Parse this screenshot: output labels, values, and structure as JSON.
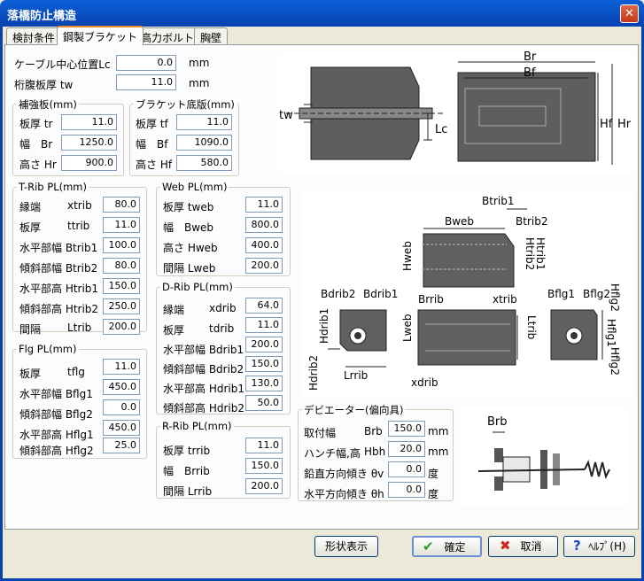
{
  "window": {
    "title": "落橋防止構造",
    "close": "✕"
  },
  "tabs": [
    "検討条件",
    "鋼製ブラケット",
    "高力ボルト",
    "胸壁"
  ],
  "top": {
    "lc_label": "ケーブル中心位置Lc",
    "lc_value": "0.0",
    "lc_unit": "mm",
    "tw_label": "桁腹板厚 tw",
    "tw_value": "11.0",
    "tw_unit": "mm"
  },
  "hokyo": {
    "title": "補強板(mm)",
    "rows": [
      {
        "label": "板厚 tr",
        "value": "11.0"
      },
      {
        "label": "幅　Br",
        "value": "1250.0"
      },
      {
        "label": "高さ Hr",
        "value": "900.0"
      }
    ]
  },
  "bracket_base": {
    "title": "ブラケット底版(mm)",
    "rows": [
      {
        "label": "板厚 tf",
        "value": "11.0"
      },
      {
        "label": "幅　Bf",
        "value": "1090.0"
      },
      {
        "label": "高さ Hf",
        "value": "580.0"
      }
    ]
  },
  "trib": {
    "title": "T-Rib PL(mm)",
    "rows": [
      {
        "label": "縁端",
        "sym": "xtrib",
        "value": "80.0"
      },
      {
        "label": "板厚",
        "sym": "ttrib",
        "value": "11.0"
      },
      {
        "label": "水平部幅 Btrib1",
        "sym": "",
        "value": "100.0"
      },
      {
        "label": "傾斜部幅 Btrib2",
        "sym": "",
        "value": "80.0"
      },
      {
        "label": "水平部高 Htrib1",
        "sym": "",
        "value": "150.0"
      },
      {
        "label": "傾斜部高 Htrib2",
        "sym": "",
        "value": "250.0"
      },
      {
        "label": "間隔",
        "sym": "Ltrib",
        "value": "200.0"
      }
    ]
  },
  "flg": {
    "title": "Flg PL(mm)",
    "rows": [
      {
        "label": "板厚",
        "sym": "tflg",
        "value": "11.0"
      },
      {
        "label": "水平部幅 Bflg1",
        "sym": "",
        "value": "450.0"
      },
      {
        "label": "傾斜部幅 Bflg2",
        "sym": "",
        "value": "0.0"
      },
      {
        "label": "水平部高 Hflg1",
        "sym": "",
        "value": "450.0"
      },
      {
        "label": "傾斜部高 Hflg2",
        "sym": "",
        "value": "25.0"
      }
    ]
  },
  "web": {
    "title": "Web PL(mm)",
    "rows": [
      {
        "label": "板厚 tweb",
        "value": "11.0"
      },
      {
        "label": "幅　Bweb",
        "value": "800.0"
      },
      {
        "label": "高さ Hweb",
        "value": "400.0"
      },
      {
        "label": "間隔 Lweb",
        "value": "200.0"
      }
    ]
  },
  "drib": {
    "title": "D-Rib PL(mm)",
    "rows": [
      {
        "label": "縁端",
        "sym": "xdrib",
        "value": "64.0"
      },
      {
        "label": "板厚",
        "sym": "tdrib",
        "value": "11.0"
      },
      {
        "label": "水平部幅 Bdrib1",
        "sym": "",
        "value": "200.0"
      },
      {
        "label": "傾斜部幅 Bdrib2",
        "sym": "",
        "value": "150.0"
      },
      {
        "label": "水平部高 Hdrib1",
        "sym": "",
        "value": "130.0"
      },
      {
        "label": "傾斜部高 Hdrib2",
        "sym": "",
        "value": "50.0"
      }
    ]
  },
  "rrib": {
    "title": "R-Rib PL(mm)",
    "rows": [
      {
        "label": "板厚 trrib",
        "value": "11.0"
      },
      {
        "label": "幅　Brrib",
        "value": "150.0"
      },
      {
        "label": "間隔 Lrrib",
        "value": "200.0"
      }
    ]
  },
  "deviator": {
    "title": "デビエーター(偏向具)",
    "rows": [
      {
        "label": "取付幅",
        "sym": "Brb",
        "value": "150.0",
        "unit": "mm"
      },
      {
        "label": "ハンチ幅,高",
        "sym": "Hbh",
        "value": "20.0",
        "unit": "mm"
      },
      {
        "label": "鉛直方向傾き θv",
        "sym": "",
        "value": "0.0",
        "unit": "度"
      },
      {
        "label": "水平方向傾き θh",
        "sym": "",
        "value": "0.0",
        "unit": "度"
      }
    ]
  },
  "diagram_labels": {
    "d1": {
      "tw": "tw",
      "lc": "Lc",
      "br": "Br",
      "bf": "Bf",
      "hf": "Hf",
      "hr": "Hr"
    },
    "d2": {
      "btrib1": "Btrib1",
      "btrib2": "Btrib2",
      "bweb": "Bweb",
      "hweb": "Hweb",
      "htrib2": "Htrib2",
      "htrib1": "Htrib1",
      "brrib": "Brrib",
      "xtrib": "xtrib",
      "bdrib2": "Bdrib2",
      "bdrib1": "Bdrib1",
      "hdrib1": "Hdrib1",
      "hdrib2": "Hdrib2",
      "lrrib": "Lrrib",
      "lweb": "Lweb",
      "ltrib": "Ltrib",
      "xdrib": "xdrib",
      "bflg1": "Bflg1",
      "bflg2": "Bflg2",
      "hflg2a": "Hflg2",
      "hflg1": "Hflg1",
      "hflg2b": "Hflg2"
    },
    "d3": {
      "brb": "Brb"
    }
  },
  "buttons": {
    "shape": "形状表示",
    "ok": "確定",
    "cancel": "取消",
    "help": "ﾍﾙﾌﾟ(H)"
  },
  "colors": {
    "title_bar": "#0842b0",
    "steel": "#606060",
    "window_bg": "#ece9d8"
  }
}
